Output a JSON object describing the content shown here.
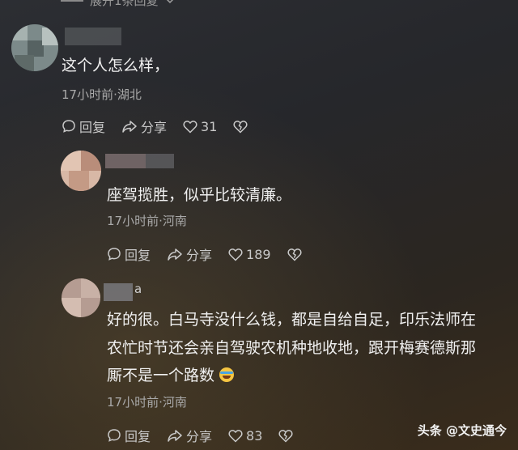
{
  "top": {
    "collapse_label": "展开1条回复"
  },
  "comments": [
    {
      "text": "这个人怎么样，",
      "meta": "17小时前·湖北",
      "reply": "回复",
      "share": "分享",
      "likes": "31"
    },
    {
      "text": "座驾揽胜，似乎比较清廉。",
      "meta": "17小时前·河南",
      "reply": "回复",
      "share": "分享",
      "likes": "189"
    },
    {
      "name_tail": "a",
      "lines": [
        "好的很。白马寺没什么钱，都是自给自足，印乐法师在",
        "农忙时节还会亲自驾驶农机种地收地，跟开梅赛德斯那",
        "厮不是一个路数"
      ],
      "meta": "17小时前·河南",
      "reply": "回复",
      "share": "分享",
      "likes": "83"
    }
  ],
  "watermark": "头条 @文史通今",
  "colors": {
    "text": "#f0f0f0",
    "meta": "#a9a9a9",
    "action": "#c9c9c9"
  }
}
